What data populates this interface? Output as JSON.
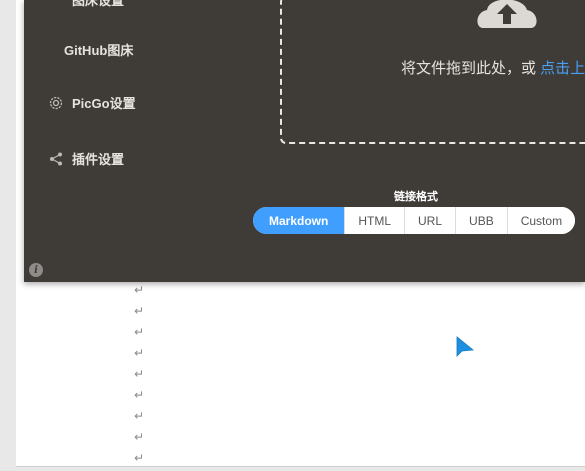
{
  "sidebar": {
    "items": [
      {
        "label": "图床设置",
        "icon": "grid-icon"
      },
      {
        "label": "GitHub图床"
      },
      {
        "label": "PicGo设置",
        "icon": "gear-icon"
      },
      {
        "label": "插件设置",
        "icon": "share-icon"
      }
    ]
  },
  "upload": {
    "text": "将文件拖到此处，或 ",
    "link": "点击上传"
  },
  "link_format": {
    "label": "链接格式",
    "options": [
      "Markdown",
      "HTML",
      "URL",
      "UBB",
      "Custom"
    ],
    "selected": "Markdown"
  },
  "document": {
    "paragraph_mark": "↵"
  },
  "colors": {
    "window_bg": "#3f3b37",
    "accent": "#409eff",
    "link": "#4aa0f7"
  }
}
